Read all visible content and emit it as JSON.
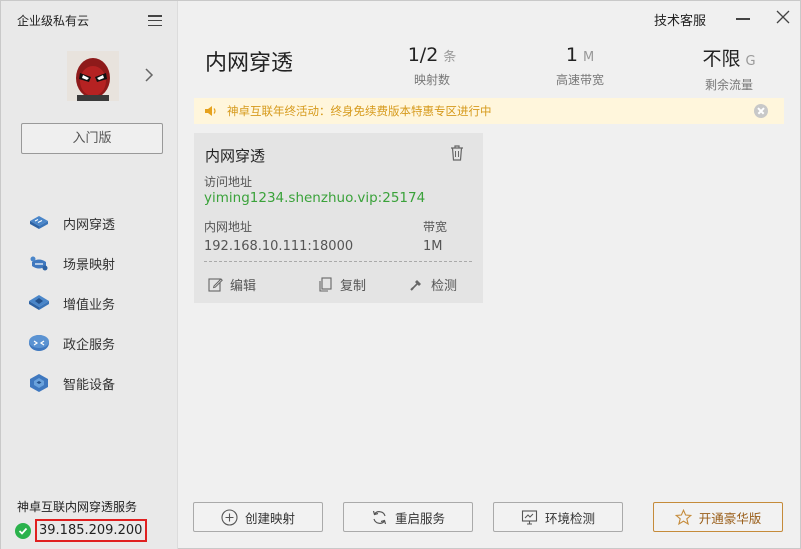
{
  "sidebar": {
    "brand": "企业级私有云",
    "edition_button": "入门版",
    "items": [
      {
        "label": "内网穿透",
        "icon": "tunnel-icon"
      },
      {
        "label": "场景映射",
        "icon": "scene-mapping-icon"
      },
      {
        "label": "增值业务",
        "icon": "value-added-icon"
      },
      {
        "label": "政企服务",
        "icon": "enterprise-icon"
      },
      {
        "label": "智能设备",
        "icon": "smart-device-icon"
      }
    ],
    "service_label": "神卓互联内网穿透服务",
    "ip": "39.185.209.200"
  },
  "titlebar": {
    "support": "技术客服"
  },
  "header": {
    "title": "内网穿透",
    "stats": [
      {
        "value": "1/2",
        "unit": "条",
        "label": "映射数"
      },
      {
        "value": "1",
        "unit": "M",
        "label": "高速带宽"
      },
      {
        "value": "不限",
        "unit": "G",
        "label": "剩余流量"
      }
    ]
  },
  "notice": {
    "text": "神卓互联年终活动：终身免续费版本特惠专区进行中",
    "color": "#d69a1c"
  },
  "card": {
    "title": "内网穿透",
    "access_label": "访问地址",
    "access_value": "yiming1234.shenzhuo.vip:25174",
    "internal_label": "内网地址",
    "internal_value": "192.168.10.111:18000",
    "bandwidth_label": "带宽",
    "bandwidth_value": "1M",
    "actions": {
      "edit": "编辑",
      "copy": "复制",
      "check": "检测"
    }
  },
  "bottom": {
    "create": "创建映射",
    "restart": "重启服务",
    "env_check": "环境检测",
    "vip": "开通豪华版"
  },
  "colors": {
    "accent_green": "#3aa23a",
    "highlight_red": "#e02020",
    "vip_gold": "#c58b3a"
  }
}
